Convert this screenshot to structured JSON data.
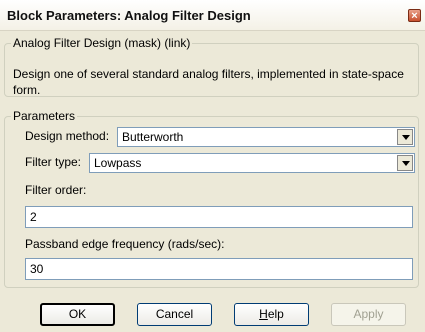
{
  "window": {
    "title": "Block Parameters: Analog Filter Design",
    "close_glyph": "×"
  },
  "mask_group": {
    "legend": "Analog Filter Design (mask) (link)",
    "description": "Design one of several standard analog filters, implemented in state-space form."
  },
  "parameters": {
    "legend": "Parameters",
    "design_method": {
      "label": "Design method:",
      "value": "Butterworth"
    },
    "filter_type": {
      "label": "Filter type:",
      "value": "Lowpass"
    },
    "filter_order": {
      "label": "Filter order:",
      "value": "2"
    },
    "passband": {
      "label": "Passband edge frequency (rads/sec):",
      "value": "30"
    }
  },
  "buttons": {
    "ok": "OK",
    "cancel": "Cancel",
    "help_letter": "H",
    "help_rest": "elp",
    "apply": "Apply"
  },
  "colors": {
    "dialog_bg": "#ece9d8",
    "field_border": "#7f9db9",
    "close_button": "#c8502f"
  }
}
